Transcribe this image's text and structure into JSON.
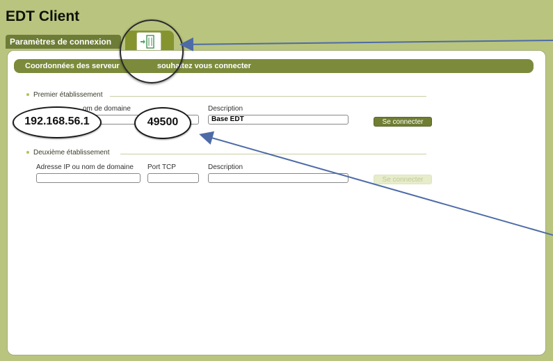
{
  "app": {
    "title": "EDT Client"
  },
  "tabs": {
    "active_label": "Paramètres de connexion",
    "icon_tab": "door-exit-icon"
  },
  "section": {
    "title_left": "Coordonnées des serveur",
    "title_right": "souhaitez vous connecter"
  },
  "establishments": [
    {
      "label": "Premier établissement",
      "ip_label_visible": "om de domaine",
      "ip_value": "192.168.56.1",
      "port_value": "49500",
      "description_label": "Description",
      "description_value": "Base EDT",
      "connect_label": "Se connecter",
      "connect_enabled": true
    },
    {
      "label": "Deuxième établissement",
      "ip_label": "Adresse IP ou nom de domaine",
      "port_label": "Port TCP",
      "description_label": "Description",
      "ip_value": "",
      "port_value": "",
      "description_value": "",
      "connect_label": "Se connecter",
      "connect_enabled": false
    }
  ],
  "colors": {
    "frame": "#b9c47f",
    "accent": "#6d7c36",
    "arrow": "#4d6ba6"
  }
}
